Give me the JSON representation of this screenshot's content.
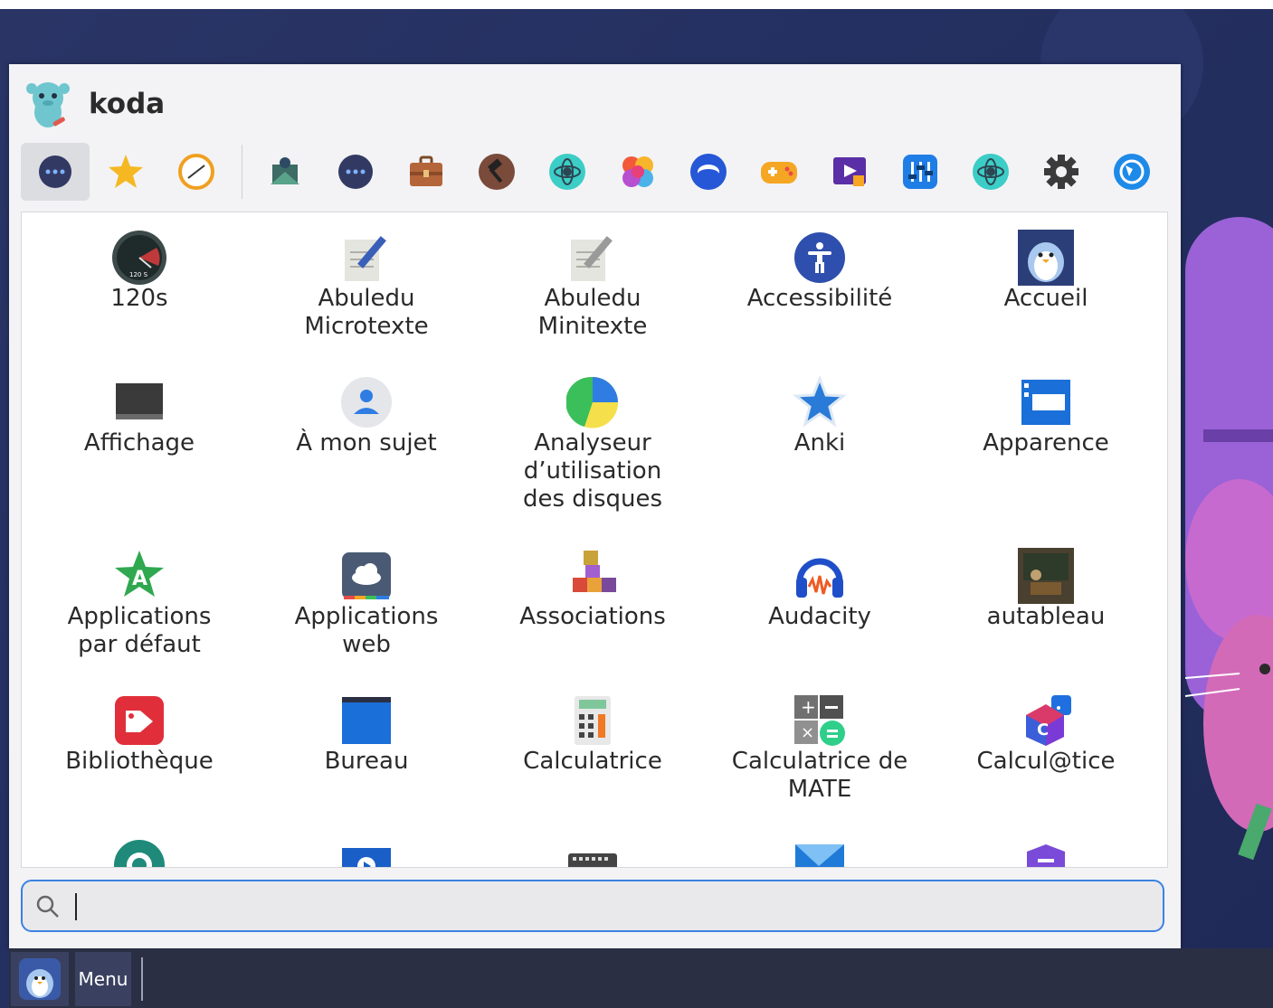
{
  "user": {
    "name": "koda",
    "avatar_icon": "koda-mascot-icon"
  },
  "categories": [
    {
      "name": "all-apps",
      "icon": "dots-icon",
      "active": true
    },
    {
      "name": "favorites",
      "icon": "star-icon"
    },
    {
      "name": "recent",
      "icon": "clock-icon"
    },
    {
      "name": "education",
      "icon": "education-icon"
    },
    {
      "name": "accessories",
      "icon": "dots-icon"
    },
    {
      "name": "office",
      "icon": "briefcase-icon"
    },
    {
      "name": "development",
      "icon": "hammer-icon"
    },
    {
      "name": "science",
      "icon": "atom-icon"
    },
    {
      "name": "graphics",
      "icon": "pinwheel-icon"
    },
    {
      "name": "internet",
      "icon": "internet-icon"
    },
    {
      "name": "games",
      "icon": "gamepad-icon"
    },
    {
      "name": "multimedia",
      "icon": "multimedia-icon"
    },
    {
      "name": "utilities",
      "icon": "sliders-icon"
    },
    {
      "name": "science-2",
      "icon": "atom-icon"
    },
    {
      "name": "settings",
      "icon": "gear-icon"
    },
    {
      "name": "web",
      "icon": "globe-icon"
    }
  ],
  "apps": [
    {
      "label": "120s",
      "icon": "speedometer-icon"
    },
    {
      "label": "Abuledu\nMicrotexte",
      "icon": "notepad-pencil-icon"
    },
    {
      "label": "Abuledu\nMinitexte",
      "icon": "notepad-pencil-gray-icon"
    },
    {
      "label": "Accessibilité",
      "icon": "accessibility-icon"
    },
    {
      "label": "Accueil",
      "icon": "penguin-icon"
    },
    {
      "label": "Affichage",
      "icon": "monitor-icon"
    },
    {
      "label": "À mon sujet",
      "icon": "person-icon"
    },
    {
      "label": "Analyseur\nd’utilisation\ndes disques",
      "icon": "pie-chart-icon"
    },
    {
      "label": "Anki",
      "icon": "star-blue-icon"
    },
    {
      "label": "Apparence",
      "icon": "window-icon"
    },
    {
      "label": "Applications\npar défaut",
      "icon": "badge-a-icon"
    },
    {
      "label": "Applications\nweb",
      "icon": "cloud-icon"
    },
    {
      "label": "Associations",
      "icon": "blocks-icon"
    },
    {
      "label": "Audacity",
      "icon": "headphones-icon"
    },
    {
      "label": "autableau",
      "icon": "blackboard-icon"
    },
    {
      "label": "Bibliothèque",
      "icon": "tag-icon"
    },
    {
      "label": "Bureau",
      "icon": "desktop-icon"
    },
    {
      "label": "Calculatrice",
      "icon": "calculator-icon"
    },
    {
      "label": "Calculatrice de\nMATE",
      "icon": "mate-calculator-icon"
    },
    {
      "label": "Calcul@tice",
      "icon": "calculatice-icon"
    },
    {
      "label": "",
      "icon": "camera-aperture-icon"
    },
    {
      "label": "",
      "icon": "video-icon"
    },
    {
      "label": "",
      "icon": "keyboard-icon"
    },
    {
      "label": "",
      "icon": "paper-icon"
    },
    {
      "label": "",
      "icon": "shield-icon"
    }
  ],
  "search": {
    "value": "",
    "placeholder": ""
  },
  "taskbar": {
    "menu_label": "Menu"
  }
}
